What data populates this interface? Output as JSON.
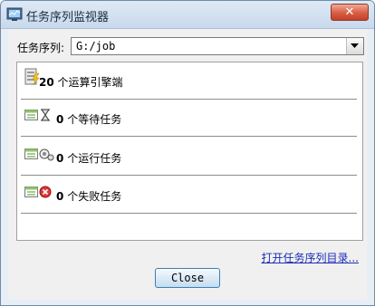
{
  "window": {
    "title": "任务序列监视器",
    "close_glyph": "✕"
  },
  "sequence": {
    "label": "任务序列:",
    "selected": "G:/job"
  },
  "status_rows": [
    {
      "icon": "engine-icon",
      "count": "20",
      "text": "个运算引擎端"
    },
    {
      "icon": "hourglass-task-icon",
      "count": "0",
      "text": "个等待任务"
    },
    {
      "icon": "running-task-icon",
      "count": "0",
      "text": "个运行任务"
    },
    {
      "icon": "failed-task-icon",
      "count": "0",
      "text": "个失败任务"
    }
  ],
  "open_link": "打开任务序列目录...",
  "close_button": "Close"
}
